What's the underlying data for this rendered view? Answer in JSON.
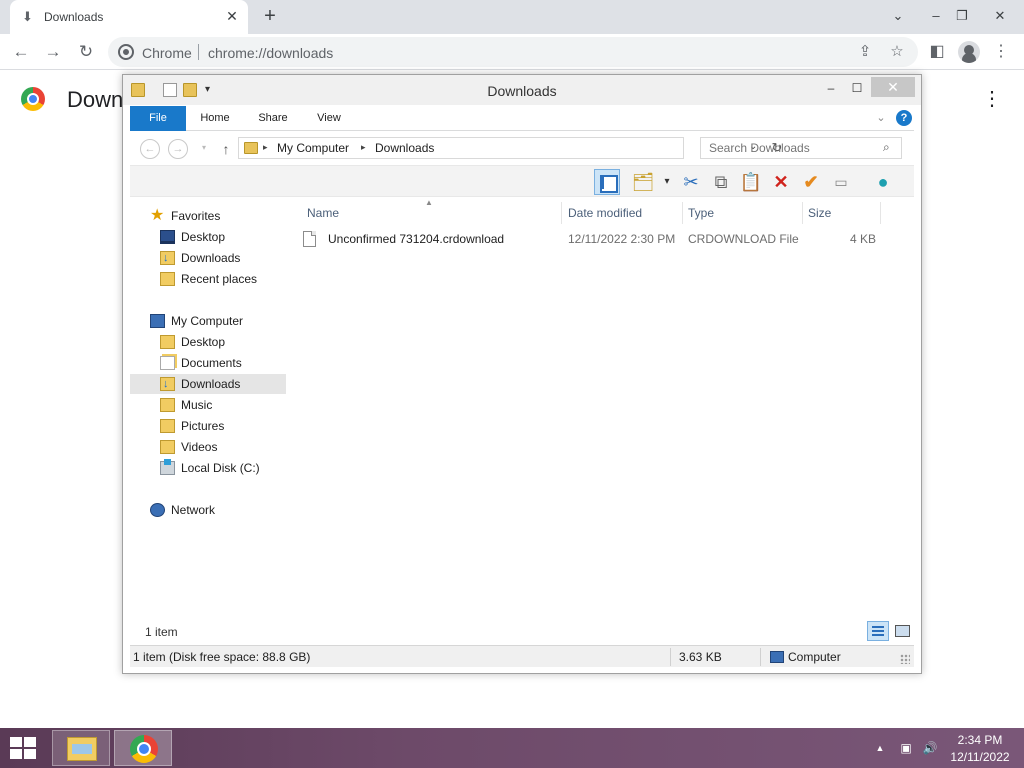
{
  "browser": {
    "tab_title": "Downloads",
    "omnibox_chip": "Chrome",
    "url": "chrome://downloads",
    "page_title": "Downloads"
  },
  "explorer": {
    "title": "Downloads",
    "ribbon_tabs": [
      "File",
      "Home",
      "Share",
      "View"
    ],
    "breadcrumb": [
      "My Computer",
      "Downloads"
    ],
    "search_placeholder": "Search Downloads",
    "nav": {
      "favorites_label": "Favorites",
      "favorites": [
        {
          "label": "Desktop",
          "icon": "desktop-icon"
        },
        {
          "label": "Downloads",
          "icon": "downloads-folder-icon"
        },
        {
          "label": "Recent places",
          "icon": "recent-places-icon"
        }
      ],
      "computer_label": "My Computer",
      "computer": [
        {
          "label": "Desktop",
          "icon": "desktop-icon"
        },
        {
          "label": "Documents",
          "icon": "documents-icon"
        },
        {
          "label": "Downloads",
          "icon": "downloads-folder-icon",
          "selected": true
        },
        {
          "label": "Music",
          "icon": "music-folder-icon"
        },
        {
          "label": "Pictures",
          "icon": "pictures-folder-icon"
        },
        {
          "label": "Videos",
          "icon": "videos-folder-icon"
        },
        {
          "label": "Local Disk (C:)",
          "icon": "local-disk-icon"
        }
      ],
      "network_label": "Network"
    },
    "columns": {
      "name": "Name",
      "date": "Date modified",
      "type": "Type",
      "size": "Size"
    },
    "files": [
      {
        "name": "Unconfirmed 731204.crdownload",
        "date": "12/11/2022 2:30 PM",
        "type": "CRDOWNLOAD File",
        "size": "4 KB"
      }
    ],
    "item_count": "1 item",
    "status": {
      "summary": "1 item (Disk free space: 88.8 GB)",
      "selected_size": "3.63 KB",
      "location": "Computer"
    }
  },
  "taskbar": {
    "time": "2:34 PM",
    "date": "12/11/2022"
  },
  "colors": {
    "accent": "#1979ca",
    "taskbar": "#6d4a69"
  }
}
